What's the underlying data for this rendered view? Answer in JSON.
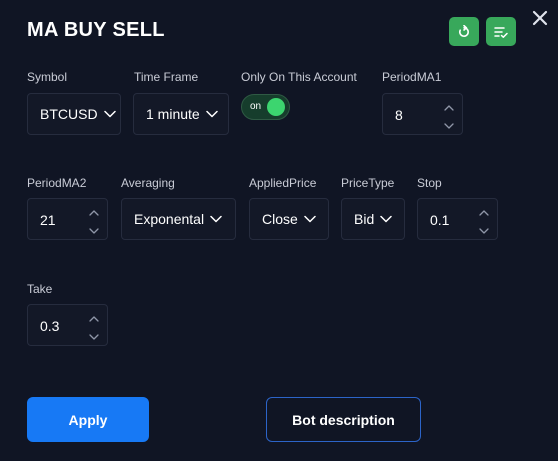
{
  "header": {
    "title": "MA BUY SELL",
    "buttons": [
      {
        "icon": "refresh-icon"
      },
      {
        "icon": "list-check-icon"
      }
    ],
    "close_icon": "close-icon"
  },
  "form": {
    "symbol": {
      "label": "Symbol",
      "value": "BTCUSD"
    },
    "time_frame": {
      "label": "Time Frame",
      "value": "1 minute"
    },
    "only_on_account": {
      "label": "Only On This Account",
      "state": "on"
    },
    "period_ma1": {
      "label": "PeriodMA1",
      "value": "8"
    },
    "period_ma2": {
      "label": "PeriodMA2",
      "value": "21"
    },
    "averaging": {
      "label": "Averaging",
      "value": "Exponental"
    },
    "applied_price": {
      "label": "AppliedPrice",
      "value": "Close"
    },
    "price_type": {
      "label": "PriceType",
      "value": "Bid"
    },
    "stop": {
      "label": "Stop",
      "value": "0.1"
    },
    "take": {
      "label": "Take",
      "value": "0.3"
    }
  },
  "actions": {
    "apply_label": "Apply",
    "description_label": "Bot description"
  },
  "colors": {
    "background": "#101524",
    "accent_green": "#38a85b",
    "toggle_green": "#3cd56f",
    "primary_blue": "#1779f5",
    "outline_blue": "#2c64c8"
  }
}
